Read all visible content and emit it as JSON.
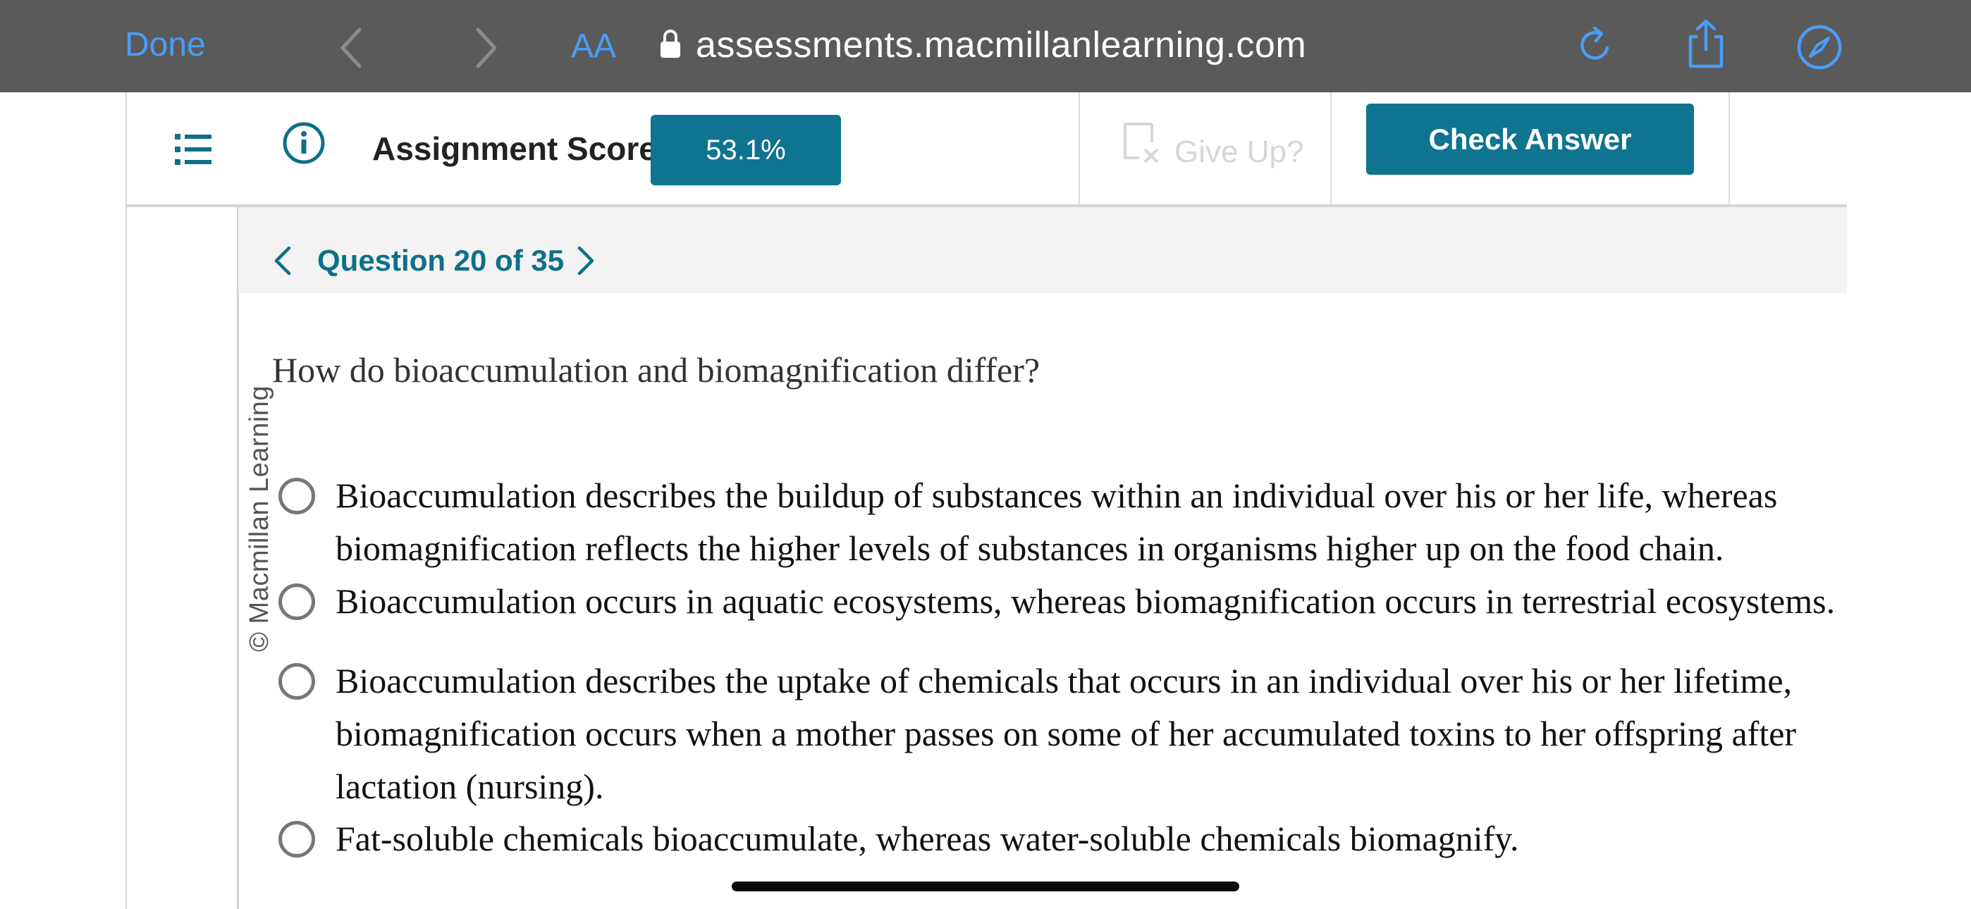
{
  "browser": {
    "done_label": "Done",
    "text_size_label": "AA",
    "url": "assessments.macmillanlearning.com",
    "icons": [
      "chevron-left-icon",
      "chevron-right-icon",
      "lock-icon",
      "reload-icon",
      "share-icon",
      "compass-icon"
    ]
  },
  "assignment": {
    "score_label": "Assignment Score:",
    "score_value": "53.1%",
    "give_up_label": "Give Up?",
    "check_answer_label": "Check Answer"
  },
  "question_nav": {
    "label": "Question 20 of 35"
  },
  "watermark": "© Macmillan Learning",
  "question": {
    "prompt": "How do bioaccumulation and biomagnification differ?",
    "options": [
      {
        "lines": [
          "Bioaccumulation describes the buildup of substances within an individual over his or her life, whereas",
          "biomagnification reflects the higher levels of substances in organisms higher up on the food chain."
        ]
      },
      {
        "lines": [
          "Bioaccumulation occurs in aquatic ecosystems, whereas biomagnification occurs in terrestrial ecosystems."
        ]
      },
      {
        "lines": [
          "Bioaccumulation describes the uptake of chemicals that occurs in an individual over his or her lifetime,",
          "biomagnification occurs when a mother passes on some of her accumulated toxins to her offspring after",
          "lactation (nursing)."
        ]
      },
      {
        "lines": [
          "Fat-soluble chemicals bioaccumulate, whereas water-soluble chemicals biomagnify."
        ]
      }
    ]
  },
  "colors": {
    "browser_bar": "#5a5a5a",
    "ios_blue": "#4a9cf7",
    "teal": "#0e7490"
  }
}
